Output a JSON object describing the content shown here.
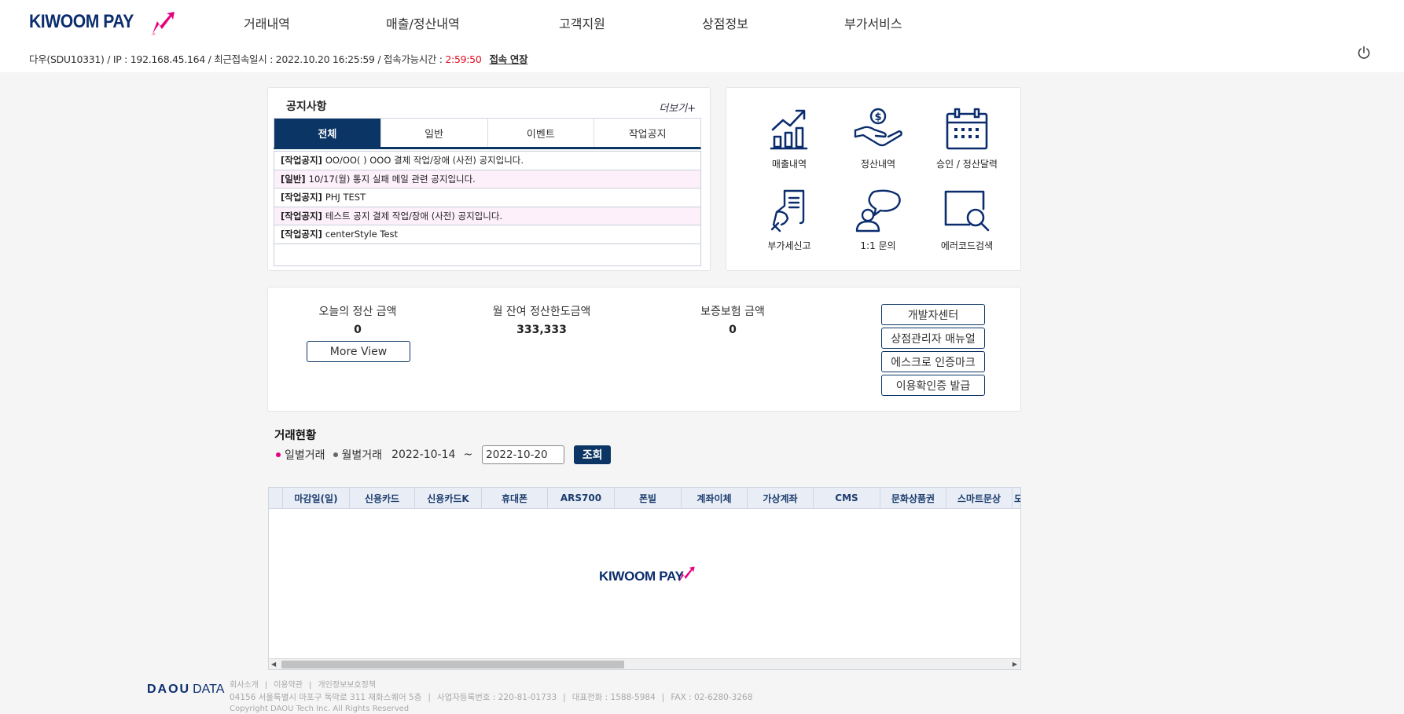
{
  "brand": {
    "logo_text": "KIWOOM PAY",
    "accent": "#e6007e",
    "navy": "#0b3564"
  },
  "nav": [
    {
      "label": "거래내역"
    },
    {
      "label": "매출/정산내역"
    },
    {
      "label": "고객지원"
    },
    {
      "label": "상점정보"
    },
    {
      "label": "부가서비스"
    }
  ],
  "session": {
    "prefix": "다우(SDU10331) / IP : 192.168.45.164 / 최근접속일시 : 2022.10.20 16:25:59 / 접속가능시간 : ",
    "remaining": "2:59:50",
    "extend_label": "접속 연장"
  },
  "notice": {
    "title": "공지사항",
    "more": "더보기+",
    "tabs": [
      {
        "label": "전체"
      },
      {
        "label": "일반"
      },
      {
        "label": "이벤트"
      },
      {
        "label": "작업공지"
      }
    ],
    "active_tab": 0,
    "items": [
      {
        "category": "[작업공지]",
        "text": "OO/OO( ) OOO 결제 작업/장애 (사전) 공지입니다."
      },
      {
        "category": "[일반]",
        "text": "10/17(월) 통지 실패 메일 관련 공지입니다."
      },
      {
        "category": "[작업공지]",
        "text": "PHJ TEST"
      },
      {
        "category": "[작업공지]",
        "text": "테스트 공지 결제 작업/장애 (사전) 공지입니다."
      },
      {
        "category": "[작업공지]",
        "text": "centerStyle Test"
      }
    ]
  },
  "quick_menu": [
    {
      "label": "매출내역",
      "icon": "sales-chart-icon"
    },
    {
      "label": "정산내역",
      "icon": "hand-coin-icon"
    },
    {
      "label": "승인 / 정산달력",
      "icon": "calendar-icon"
    },
    {
      "label": "부가세신고",
      "icon": "receipt-hand-icon"
    },
    {
      "label": "1:1 문의",
      "icon": "person-chat-icon"
    },
    {
      "label": "에러코드검색",
      "icon": "magnifier-icon"
    }
  ],
  "summary": {
    "today_label": "오늘의 정산 금액",
    "today_value": "0",
    "more_view": "More View",
    "monthly_label": "월 잔여 정산한도금액",
    "monthly_value": "333,333",
    "insurance_label": "보증보험 금액",
    "insurance_value": "0",
    "buttons": [
      {
        "label": "개발자센터"
      },
      {
        "label": "상점관리자 매뉴얼"
      },
      {
        "label": "에스크로 인증마크"
      },
      {
        "label": "이용확인증 발급"
      }
    ]
  },
  "transactions": {
    "title": "거래현황",
    "daily": "일별거래",
    "monthly": "월별거래",
    "date_from": "2022-10-14",
    "tilde": "~",
    "date_to": "2022-10-20",
    "search": "조회",
    "columns": [
      "",
      "마감일(일)",
      "신용카드",
      "신용카드K",
      "휴대폰",
      "ARS700",
      "폰빌",
      "계좌이체",
      "가상계좌",
      "CMS",
      "문화상품권",
      "스마트문상",
      "도"
    ],
    "empty_logo": "KIWOOM PAY"
  },
  "footer": {
    "logo_bold": "DAOU",
    "logo_rest": "DATA",
    "links": [
      "회사소개",
      "이용약관",
      "개인정보보호정책"
    ],
    "address_parts": [
      "04156 서울특별시 마포구 독막로 311 재화스퀘어 5층",
      "사업자등록번호 : 220-81-01733",
      "대표전화 : 1588-5984",
      "FAX : 02-6280-3268"
    ],
    "copyright": "Copyright DAOU Tech Inc. All Rights Reserved"
  }
}
